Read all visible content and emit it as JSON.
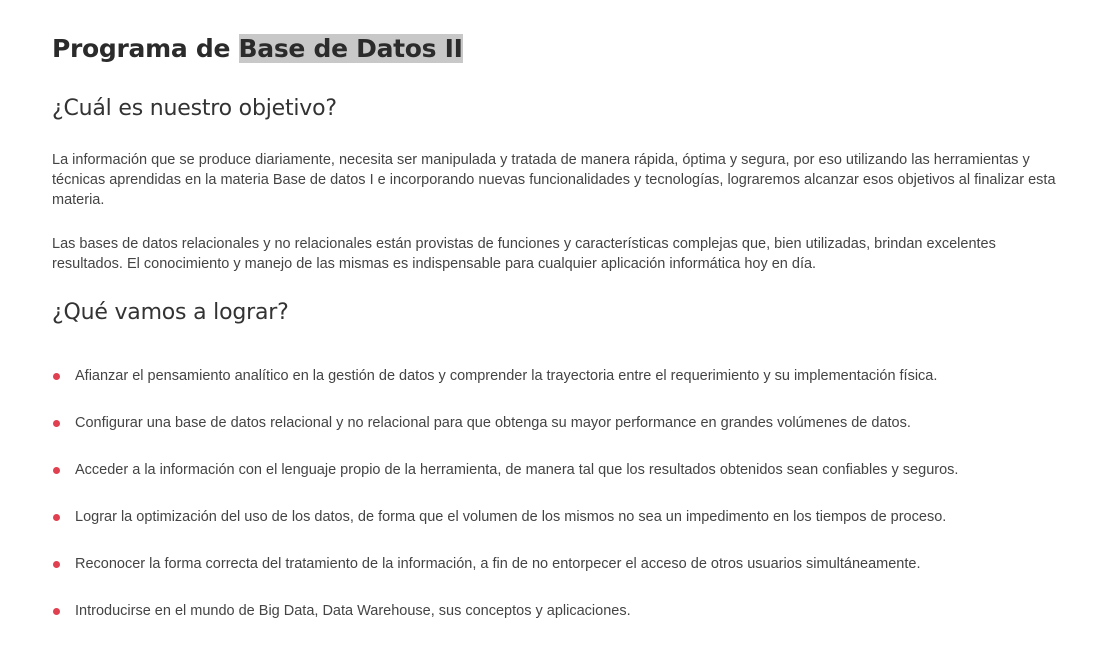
{
  "title": {
    "prefix": "Programa de ",
    "highlighted": "Base de Datos II"
  },
  "section_objective": {
    "heading": "¿Cuál es nuestro objetivo?",
    "paragraphs": [
      "La información que se produce diariamente, necesita ser manipulada y tratada de manera rápida, óptima y segura, por eso utilizando las herramientas y técnicas aprendidas en la materia Base de datos I e incorporando nuevas funcionalidades y tecnologías, lograremos alcanzar esos objetivos al finalizar esta materia.",
      "Las bases de datos relacionales y no relacionales están provistas de funciones y características complejas que, bien utilizadas, brindan excelentes resultados. El conocimiento y manejo de las mismas es indispensable para cualquier aplicación informática hoy en día."
    ]
  },
  "section_goals": {
    "heading": "¿Qué vamos a lograr?",
    "items": [
      "Afianzar el pensamiento analítico en la gestión de datos y comprender la trayectoria entre el requerimiento y su implementación física.",
      "Configurar una base de datos relacional y no relacional para que obtenga su mayor performance en grandes volúmenes de datos.",
      "Acceder a la información con el lenguaje propio de la herramienta, de manera tal que los resultados obtenidos sean confiables y seguros.",
      "Lograr la optimización del uso de los datos, de forma que el volumen de los mismos no sea un impedimento en los tiempos de proceso.",
      "Reconocer la forma correcta del tratamiento de la información, a fin de no entorpecer el acceso de otros usuarios simultáneamente.",
      "Introducirse en el mundo de Big Data, Data Warehouse, sus conceptos y aplicaciones."
    ],
    "bullet_color": "#e0404f"
  },
  "colors": {
    "heading": "#2b2b2b",
    "body_text": "#444444",
    "selection_highlight": "#c8c8c8"
  }
}
